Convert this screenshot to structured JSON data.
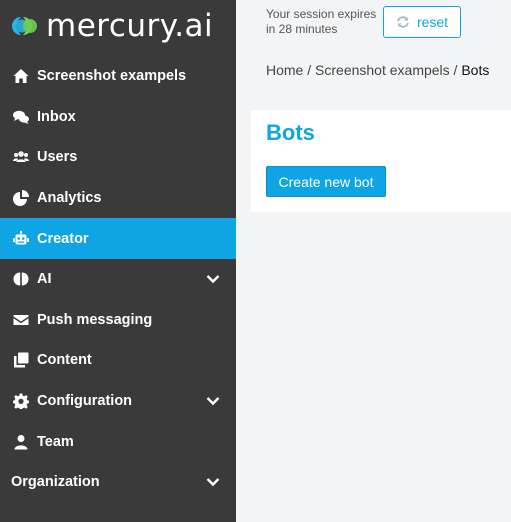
{
  "brand": {
    "name": "mercury.ai"
  },
  "colors": {
    "accent": "#0fa4e4",
    "sidebar_bg": "#3a3a3a",
    "page_bg": "#f3f4f6"
  },
  "sidebar": {
    "items": [
      {
        "label": "Screenshot exampels",
        "icon": "home-icon"
      },
      {
        "label": "Inbox",
        "icon": "chat-bubbles-icon"
      },
      {
        "label": "Users",
        "icon": "users-icon"
      },
      {
        "label": "Analytics",
        "icon": "pie-chart-icon"
      },
      {
        "label": "Creator",
        "icon": "robot-icon",
        "active": true
      },
      {
        "label": "AI",
        "icon": "brain-icon",
        "expandable": true
      },
      {
        "label": "Push messaging",
        "icon": "envelope-icon"
      },
      {
        "label": "Content",
        "icon": "copy-icon"
      },
      {
        "label": "Configuration",
        "icon": "gear-icon",
        "expandable": true
      },
      {
        "label": "Team",
        "icon": "user-icon"
      }
    ],
    "organization_label": "Organization"
  },
  "header": {
    "session_line1": "Your session expires",
    "session_line2": "in 28 minutes",
    "reset_label": "reset"
  },
  "breadcrumb": {
    "home": "Home",
    "sep": " / ",
    "project": "Screenshot exampels",
    "current": "Bots"
  },
  "main": {
    "title": "Bots",
    "create_button": "Create new bot"
  }
}
